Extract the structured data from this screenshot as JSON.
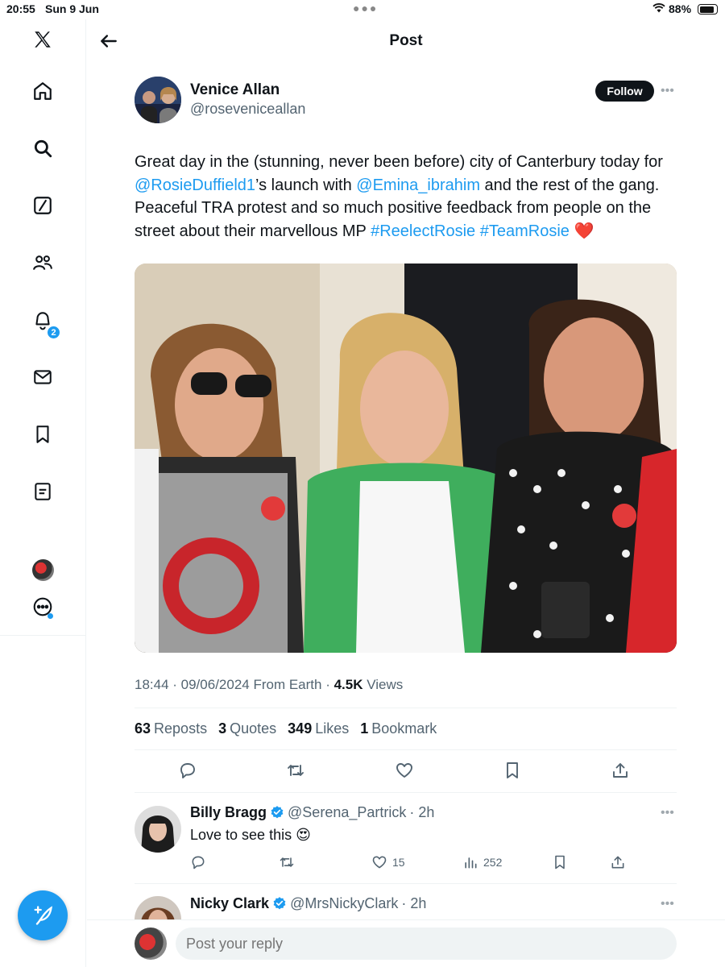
{
  "status_bar": {
    "time": "20:55",
    "date": "Sun 9 Jun",
    "battery": "88%"
  },
  "nav": {
    "items": [
      "x-logo-icon",
      "home-icon",
      "search-icon",
      "grok-icon",
      "communities-icon",
      "notifications-icon",
      "messages-icon",
      "bookmarks-icon",
      "lists-icon",
      "profile-avatar",
      "more-icon"
    ],
    "notification_count": "2"
  },
  "header": {
    "title": "Post"
  },
  "tweet": {
    "author_name": "Venice Allan",
    "author_handle": "@roseveniceallan",
    "follow_label": "Follow",
    "text_parts": {
      "p1": "Great day in the (stunning, never been before) city of Canterbury today for ",
      "m1": "@RosieDuffield1",
      "p2": "’s launch with ",
      "m2": "@Emina_ibrahim",
      "p3": " and the rest of the gang. Peaceful TRA protest and so much positive feedback from people on the street about their marvellous MP ",
      "h1": "#ReelectRosie",
      "h2": "#TeamRosie",
      "emoji": "❤️"
    },
    "timestamp": "18:44 · 09/06/2024 From Earth · ",
    "views_count": "4.5K",
    "views_label": " Views",
    "stats": {
      "reposts": "63",
      "reposts_label": "Reposts",
      "quotes": "3",
      "quotes_label": "Quotes",
      "likes": "349",
      "likes_label": "Likes",
      "bookmarks": "1",
      "bookmarks_label": "Bookmark"
    }
  },
  "replies": [
    {
      "name": "Billy Bragg",
      "handle": "@Serena_Partrick",
      "time": "· 2h",
      "text": "Love to see this 😍",
      "likes": "15",
      "views": "252"
    },
    {
      "name": "Nicky Clark",
      "handle": "@MrsNickyClark",
      "time": "· 2h"
    }
  ],
  "composer": {
    "placeholder": "Post your reply"
  },
  "colors": {
    "accent": "#1d9bf0",
    "text": "#0f1419",
    "muted": "#536471"
  }
}
